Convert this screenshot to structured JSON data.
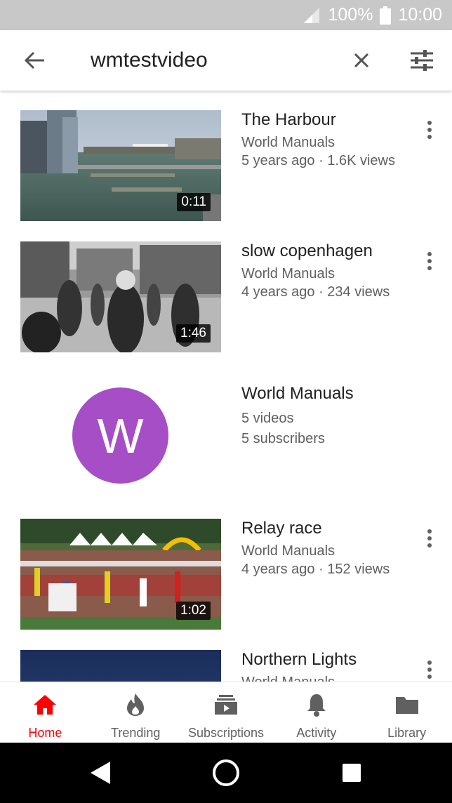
{
  "status_bar": {
    "battery": "100%",
    "time": "10:00"
  },
  "search": {
    "query": "wmtestvideo"
  },
  "results": [
    {
      "title": "The Harbour",
      "channel": "World Manuals",
      "meta": "5 years ago · 1.6K views",
      "duration": "0:11"
    },
    {
      "title": "slow copenhagen",
      "channel": "World Manuals",
      "meta": "4 years ago · 234 views",
      "duration": "1:46"
    },
    {
      "title": "Relay race",
      "channel": "World Manuals",
      "meta": "4 years ago · 152 views",
      "duration": "1:02"
    },
    {
      "title": "Northern Lights",
      "channel": "World Manuals"
    }
  ],
  "channel_result": {
    "avatar_letter": "W",
    "name": "World Manuals",
    "videos": "5 videos",
    "subscribers": "5 subscribers",
    "avatar_color": "#a64ec6"
  },
  "bottom_nav": {
    "items": [
      {
        "label": "Home",
        "icon": "home-icon",
        "active": true
      },
      {
        "label": "Trending",
        "icon": "flame-icon"
      },
      {
        "label": "Subscriptions",
        "icon": "subscriptions-icon"
      },
      {
        "label": "Activity",
        "icon": "bell-icon"
      },
      {
        "label": "Library",
        "icon": "folder-icon"
      }
    ]
  },
  "colors": {
    "accent": "#ff0000",
    "status_bar": "#c8c8c8"
  }
}
